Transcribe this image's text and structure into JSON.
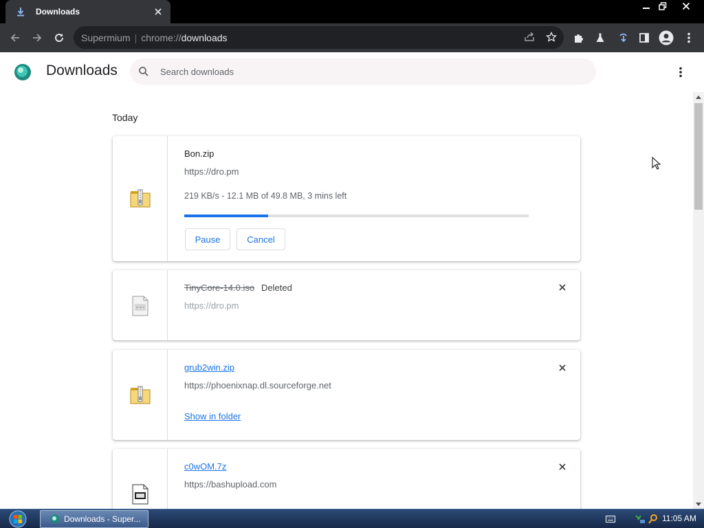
{
  "browser": {
    "tab_title": "Downloads",
    "omnibox": {
      "host": "Supermium",
      "scheme": "chrome://",
      "path": "downloads"
    }
  },
  "downloads_page": {
    "title": "Downloads",
    "search_placeholder": "Search downloads",
    "section_label": "Today",
    "items": [
      {
        "name": "Bon.zip",
        "url": "https://dro.pm",
        "status": "219 KB/s - 12.1 MB of 49.8 MB, 3 mins left",
        "progress": 0.243,
        "icon": "zip-archive-icon",
        "buttons": {
          "pause": "Pause",
          "cancel": "Cancel"
        }
      },
      {
        "name": "TinyCore-14.0.iso",
        "tag": "Deleted",
        "url": "https://dro.pm",
        "icon": "generic-file-icon"
      },
      {
        "name": "grub2win.zip",
        "url": "https://phoenixnap.dl.sourceforge.net",
        "action": "Show in folder",
        "icon": "zip-archive-icon"
      },
      {
        "name": "c0wOM.7z",
        "url": "https://bashupload.com",
        "icon": "generic-file-icon"
      }
    ]
  },
  "taskbar": {
    "task_label": "Downloads - Super...",
    "clock": "11:05 AM"
  },
  "colors": {
    "accent": "#1a73e8",
    "titlebar": "#000000",
    "toolbar": "#35363a",
    "omnibox": "#202124"
  }
}
